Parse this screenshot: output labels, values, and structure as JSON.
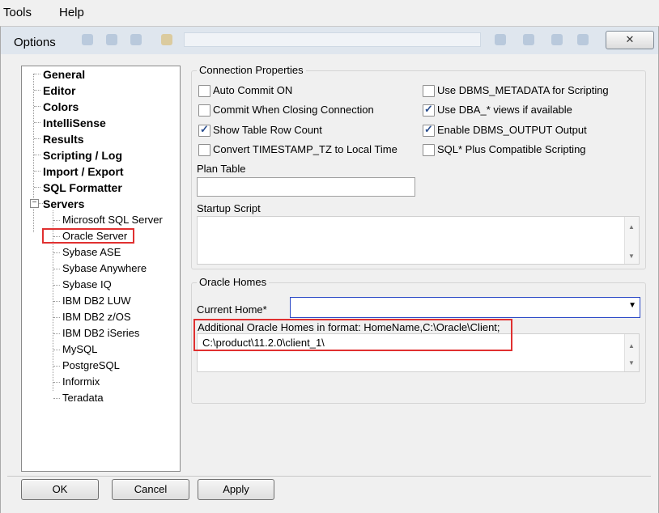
{
  "menubar": {
    "tools": "Tools",
    "help": "Help"
  },
  "dialog": {
    "title": "Options",
    "close_icon": "close-icon"
  },
  "tree": {
    "categories": [
      "General",
      "Editor",
      "Colors",
      "IntelliSense",
      "Results",
      "Scripting / Log",
      "Import / Export",
      "SQL Formatter",
      "Servers"
    ],
    "servers": [
      "Microsoft SQL Server",
      "Oracle Server",
      "Sybase ASE",
      "Sybase Anywhere",
      "Sybase IQ",
      "IBM DB2 LUW",
      "IBM DB2 z/OS",
      "IBM DB2 iSeries",
      "MySQL",
      "PostgreSQL",
      "Informix",
      "Teradata"
    ],
    "selected": "Oracle Server",
    "expander": "−"
  },
  "connection": {
    "title": "Connection Properties",
    "options": [
      {
        "label": "Auto Commit ON",
        "checked": false
      },
      {
        "label": "Commit When Closing Connection",
        "checked": false
      },
      {
        "label": "Show Table Row Count",
        "checked": true
      },
      {
        "label": "Convert TIMESTAMP_TZ to Local Time",
        "checked": false
      },
      {
        "label": "Use DBMS_METADATA for Scripting",
        "checked": false
      },
      {
        "label": "Use DBA_* views if available",
        "checked": true
      },
      {
        "label": "Enable DBMS_OUTPUT Output",
        "checked": true
      },
      {
        "label": "SQL* Plus Compatible Scripting",
        "checked": false
      }
    ],
    "plan_table_label": "Plan Table",
    "plan_table_value": "",
    "startup_script_label": "Startup Script",
    "startup_script_value": ""
  },
  "oracle_homes": {
    "title": "Oracle Homes",
    "current_home_label": "Current Home*",
    "current_home_value": "",
    "additional_label": "Additional Oracle Homes in format: HomeName,C:\\Oracle\\Client;",
    "additional_value": "C:\\product\\11.2.0\\client_1\\"
  },
  "buttons": {
    "ok": "OK",
    "cancel": "Cancel",
    "apply": "Apply"
  }
}
